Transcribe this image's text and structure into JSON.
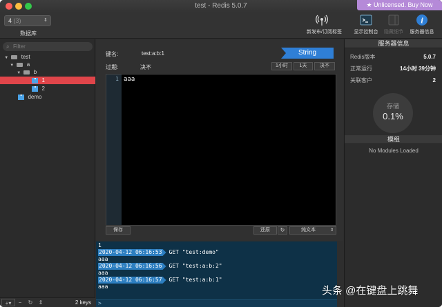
{
  "window": {
    "title": "test - Redis 5.0.7",
    "license_badge": "★ Unlicensed. Buy Now"
  },
  "toolbar": {
    "db_select": {
      "value": "4",
      "count": "(3)"
    },
    "db_label": "数据库",
    "buttons": [
      {
        "label": "新发布/订阅标签",
        "icon": "broadcast-icon"
      },
      {
        "label": "显示控制台",
        "icon": "terminal-icon"
      },
      {
        "label": "隐藏细节",
        "icon": "details-icon"
      },
      {
        "label": "服务器信息",
        "icon": "info-icon"
      }
    ]
  },
  "sidebar": {
    "filter_placeholder": "Filter",
    "tree": [
      {
        "label": "test",
        "type": "folder"
      },
      {
        "label": "a",
        "type": "folder"
      },
      {
        "label": "b",
        "type": "folder"
      },
      {
        "label": "1",
        "type": "key",
        "selected": true
      },
      {
        "label": "2",
        "type": "key"
      },
      {
        "label": "demo",
        "type": "key"
      }
    ],
    "key_count": "2 keys"
  },
  "editor": {
    "key_label": "键名:",
    "key_name": "test:a:b:1",
    "type": "String",
    "ttl_label": "过期:",
    "ttl_value": "决不",
    "ttl_buttons": [
      "1小时",
      "1天",
      "决不"
    ],
    "line_number": "1",
    "content": "aaa",
    "save_label": "保存",
    "reset_label": "还原",
    "format": "纯文本"
  },
  "console": {
    "lines": [
      {
        "text": "1"
      },
      {
        "timestamp": "2020-04-12 06:16:53",
        "command": "GET \"test:demo\""
      },
      {
        "text": "aaa"
      },
      {
        "timestamp": "2020-04-12 06:16:56",
        "command": "GET \"test:a:b:2\""
      },
      {
        "text": "aaa"
      },
      {
        "timestamp": "2020-04-12 06:16:57",
        "command": "GET \"test:a:b:1\""
      },
      {
        "text": "aaa"
      }
    ],
    "prompt": ">"
  },
  "server_info": {
    "header": "服务器信息",
    "rows": [
      {
        "key": "Redis版本",
        "value": "5.0.7"
      },
      {
        "key": "正常运行",
        "value": "14小时 39分钟"
      },
      {
        "key": "关联客户",
        "value": "2"
      }
    ],
    "storage_label": "存储",
    "storage_value": "0.1%",
    "modules_header": "模组",
    "modules_empty": "No Modules Loaded"
  },
  "watermark": "头条 @在键盘上跳舞",
  "colors": {
    "accent": "#2f7fd6",
    "selection": "#e0454a",
    "license": "#b58ad8",
    "console_bg": "#0e3147"
  }
}
